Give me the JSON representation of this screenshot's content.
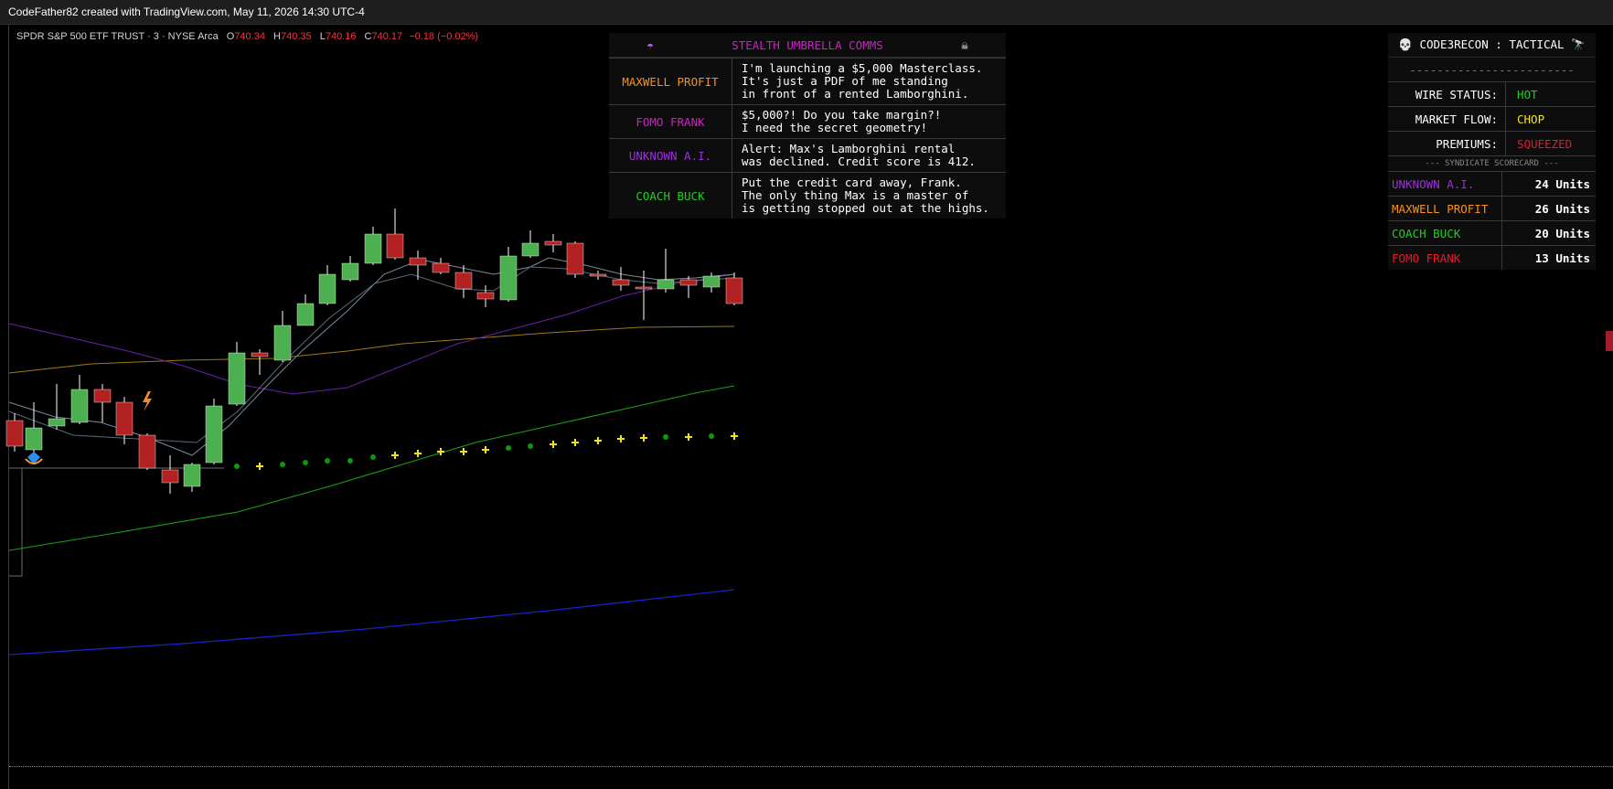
{
  "topbar": {
    "text": "CodeFather82 created with TradingView.com, May 11, 2026 14:30 UTC-4"
  },
  "header": {
    "symbol": "SPDR S&P 500 ETF TRUST · 3 · NYSE Arca",
    "o_label": "O",
    "o_value": "740.34",
    "h_label": "H",
    "h_value": "740.35",
    "l_label": "L",
    "l_value": "740.16",
    "c_label": "C",
    "c_value": "740.17",
    "change": "−0.18 (−0.02%)"
  },
  "comms": {
    "icon_left": "umbrella-icon",
    "title": "STEALTH UMBRELLA COMMS",
    "icon_right": "skull-crossbones-icon",
    "rows": [
      {
        "who": "MAXWELL PROFIT",
        "color": "#f7931a",
        "msg": "I'm launching a $5,000 Masterclass.\nIt's just a PDF of me standing\nin front of a rented Lamborghini."
      },
      {
        "who": "FOMO FRANK",
        "color": "#d11fc8",
        "msg": "$5,000?! Do you take margin?!\nI need the secret geometry!"
      },
      {
        "who": "UNKNOWN A.I.",
        "color": "#9b30d9",
        "msg": "Alert: Max's Lamborghini rental\nwas declined. Credit score is 412."
      },
      {
        "who": "COACH BUCK",
        "color": "#1fd11f",
        "msg": "Put the credit card away, Frank.\nThe only thing Max is a master of\nis getting stopped out at the highs."
      }
    ]
  },
  "tactical": {
    "title": "💀 CODE3RECON : TACTICAL 🔭",
    "divider": "------------------------",
    "status": [
      {
        "key": "WIRE STATUS:",
        "value": "HOT",
        "color": "#1fd11f"
      },
      {
        "key": "MARKET FLOW:",
        "value": "CHOP",
        "color": "#f5e31a"
      },
      {
        "key": "PREMIUMS:",
        "value": "SQUEEZED",
        "color": "#e8192c"
      }
    ],
    "scorecard_title": "--- SYNDICATE SCORECARD ---",
    "scores": [
      {
        "name": "UNKNOWN A.I.",
        "units": "24 Units",
        "color": "#9b30d9"
      },
      {
        "name": "MAXWELL PROFIT",
        "units": "26 Units",
        "color": "#f7931a"
      },
      {
        "name": "COACH BUCK",
        "units": "20 Units",
        "color": "#1fd11f"
      },
      {
        "name": "FOMO FRANK",
        "units": "13 Units",
        "color": "#e8192c"
      }
    ]
  },
  "colors": {
    "up": "#4caf50",
    "down": "#b22222",
    "wick": "#ffffff",
    "ema_gold": "#a07a10",
    "ema_purple": "#6a1fa8",
    "ema_green": "#18a018",
    "ema_blue": "#1a22c8",
    "dot_green": "#0a9a0a",
    "dot_yellow": "#f5e31a"
  },
  "markers": {
    "bolt": "lightning-icon",
    "diamond": "diamond-icon"
  }
}
